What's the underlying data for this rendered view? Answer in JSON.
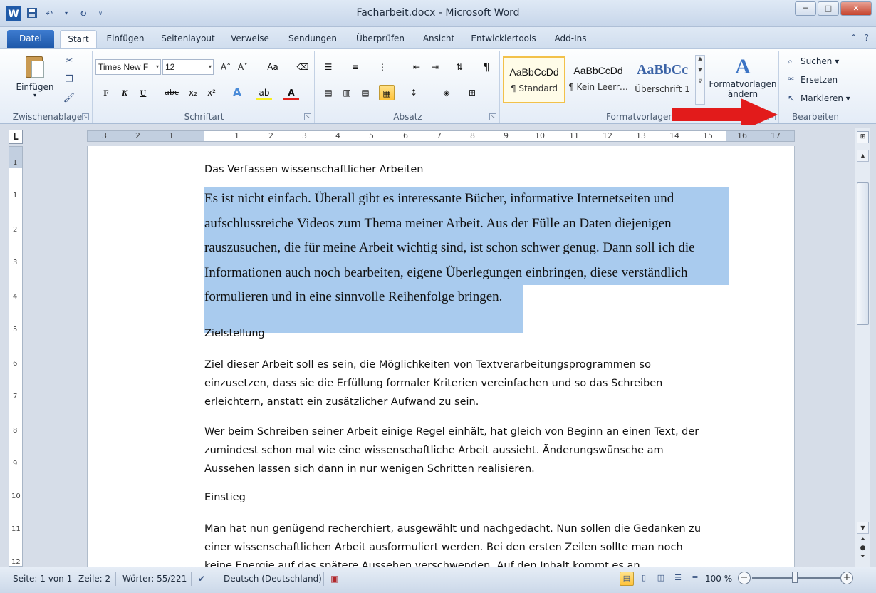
{
  "window": {
    "title": "Facharbeit.docx - Microsoft Word",
    "minimize": "─",
    "maximize": "□",
    "close": "✕"
  },
  "qat": {
    "app_icon": "W",
    "save_icon": "floppy-disk-icon",
    "undo_icon": "undo-icon",
    "redo_icon": "redo-icon"
  },
  "tabs": [
    "Datei",
    "Start",
    "Einfügen",
    "Seitenlayout",
    "Verweise",
    "Sendungen",
    "Überprüfen",
    "Ansicht",
    "Entwicklertools",
    "Add-Ins"
  ],
  "active_tab": "Start",
  "ribbon": {
    "clipboard": {
      "label": "Zwischenablage",
      "paste": "Einfügen"
    },
    "font": {
      "label": "Schriftart",
      "font_name": "Times New F",
      "font_size": "12",
      "bold": "F",
      "italic": "K",
      "underline": "U",
      "strike": "abc",
      "sub": "x₂",
      "sup": "x²",
      "grow": "A˄",
      "shrink": "A˅",
      "case": "Aa"
    },
    "paragraph": {
      "label": "Absatz",
      "pilcrow": "¶"
    },
    "styles": {
      "label": "Formatvorlagen",
      "items": [
        {
          "sample": "AaBbCcDd",
          "name": "¶ Standard"
        },
        {
          "sample": "AaBbCcDd",
          "name": "¶ Kein Leerr…"
        },
        {
          "sample": "AaBbCc",
          "name": "Überschrift 1"
        }
      ],
      "change_line1": "Formatvorlagen",
      "change_line2": "ändern"
    },
    "editing": {
      "label": "Bearbeiten",
      "find": "Suchen",
      "replace": "Ersetzen",
      "select": "Markieren"
    }
  },
  "ruler": {
    "corner": "L",
    "numbers": [
      "3",
      "2",
      "1",
      "1",
      "2",
      "3",
      "4",
      "5",
      "6",
      "7",
      "8",
      "9",
      "10",
      "11",
      "12",
      "13",
      "14",
      "15",
      "16",
      "17"
    ],
    "left_numbers": [
      "1",
      "1",
      "2",
      "3",
      "4",
      "5",
      "6",
      "7",
      "8",
      "9",
      "10",
      "11",
      "12"
    ]
  },
  "document": {
    "heading1": "Das Verfassen wissenschaftlicher Arbeiten",
    "selected_lines": [
      "Es ist nicht einfach. Überall gibt es interessante Bücher, informative Internetseiten und",
      "aufschlussreiche Videos zum Thema meiner Arbeit. Aus der Fülle an Daten diejenigen",
      "rauszusuchen, die für meine Arbeit wichtig sind, ist schon schwer genug. Dann soll ich die",
      "Informationen auch noch bearbeiten, eigene Überlegungen einbringen, diese verständlich",
      "formulieren und in eine sinnvolle Reihenfolge bringen."
    ],
    "heading2": "Zielstellung",
    "para1": [
      "Ziel dieser Arbeit soll es sein, die Möglichkeiten von Textverarbeitungsprogrammen  so",
      "einzusetzen, dass sie die Erfüllung formaler Kriterien vereinfachen und so das Schreiben",
      "erleichtern, anstatt ein zusätzlicher Aufwand zu sein."
    ],
    "para2": [
      "Wer beim Schreiben seiner Arbeit einige Regel einhält, hat gleich von Beginn an einen Text, der",
      "zumindest schon mal wie eine wissenschaftliche Arbeit aussieht. Änderungswünsche  am",
      "Aussehen lassen sich dann in nur wenigen Schritten realisieren."
    ],
    "heading3": "Einstieg",
    "para3": [
      "Man hat nun genügend recherchiert, ausgewählt und nachgedacht. Nun sollen die Gedanken zu",
      "einer wissenschaftlichen Arbeit ausformuliert werden. Bei den ersten Zeilen sollte man noch",
      "keine Energie auf das spätere Aussehen verschwenden. Auf den Inhalt kommt es an."
    ]
  },
  "statusbar": {
    "page": "Seite: 1 von 1",
    "line": "Zeile: 2",
    "words": "Wörter: 55/221",
    "language": "Deutsch (Deutschland)",
    "zoom": "100 %",
    "zoom_out": "−",
    "zoom_in": "+"
  },
  "colors": {
    "selection": "#a9cbee",
    "accent": "#1f5aa8",
    "arrow": "#e21b1b"
  }
}
